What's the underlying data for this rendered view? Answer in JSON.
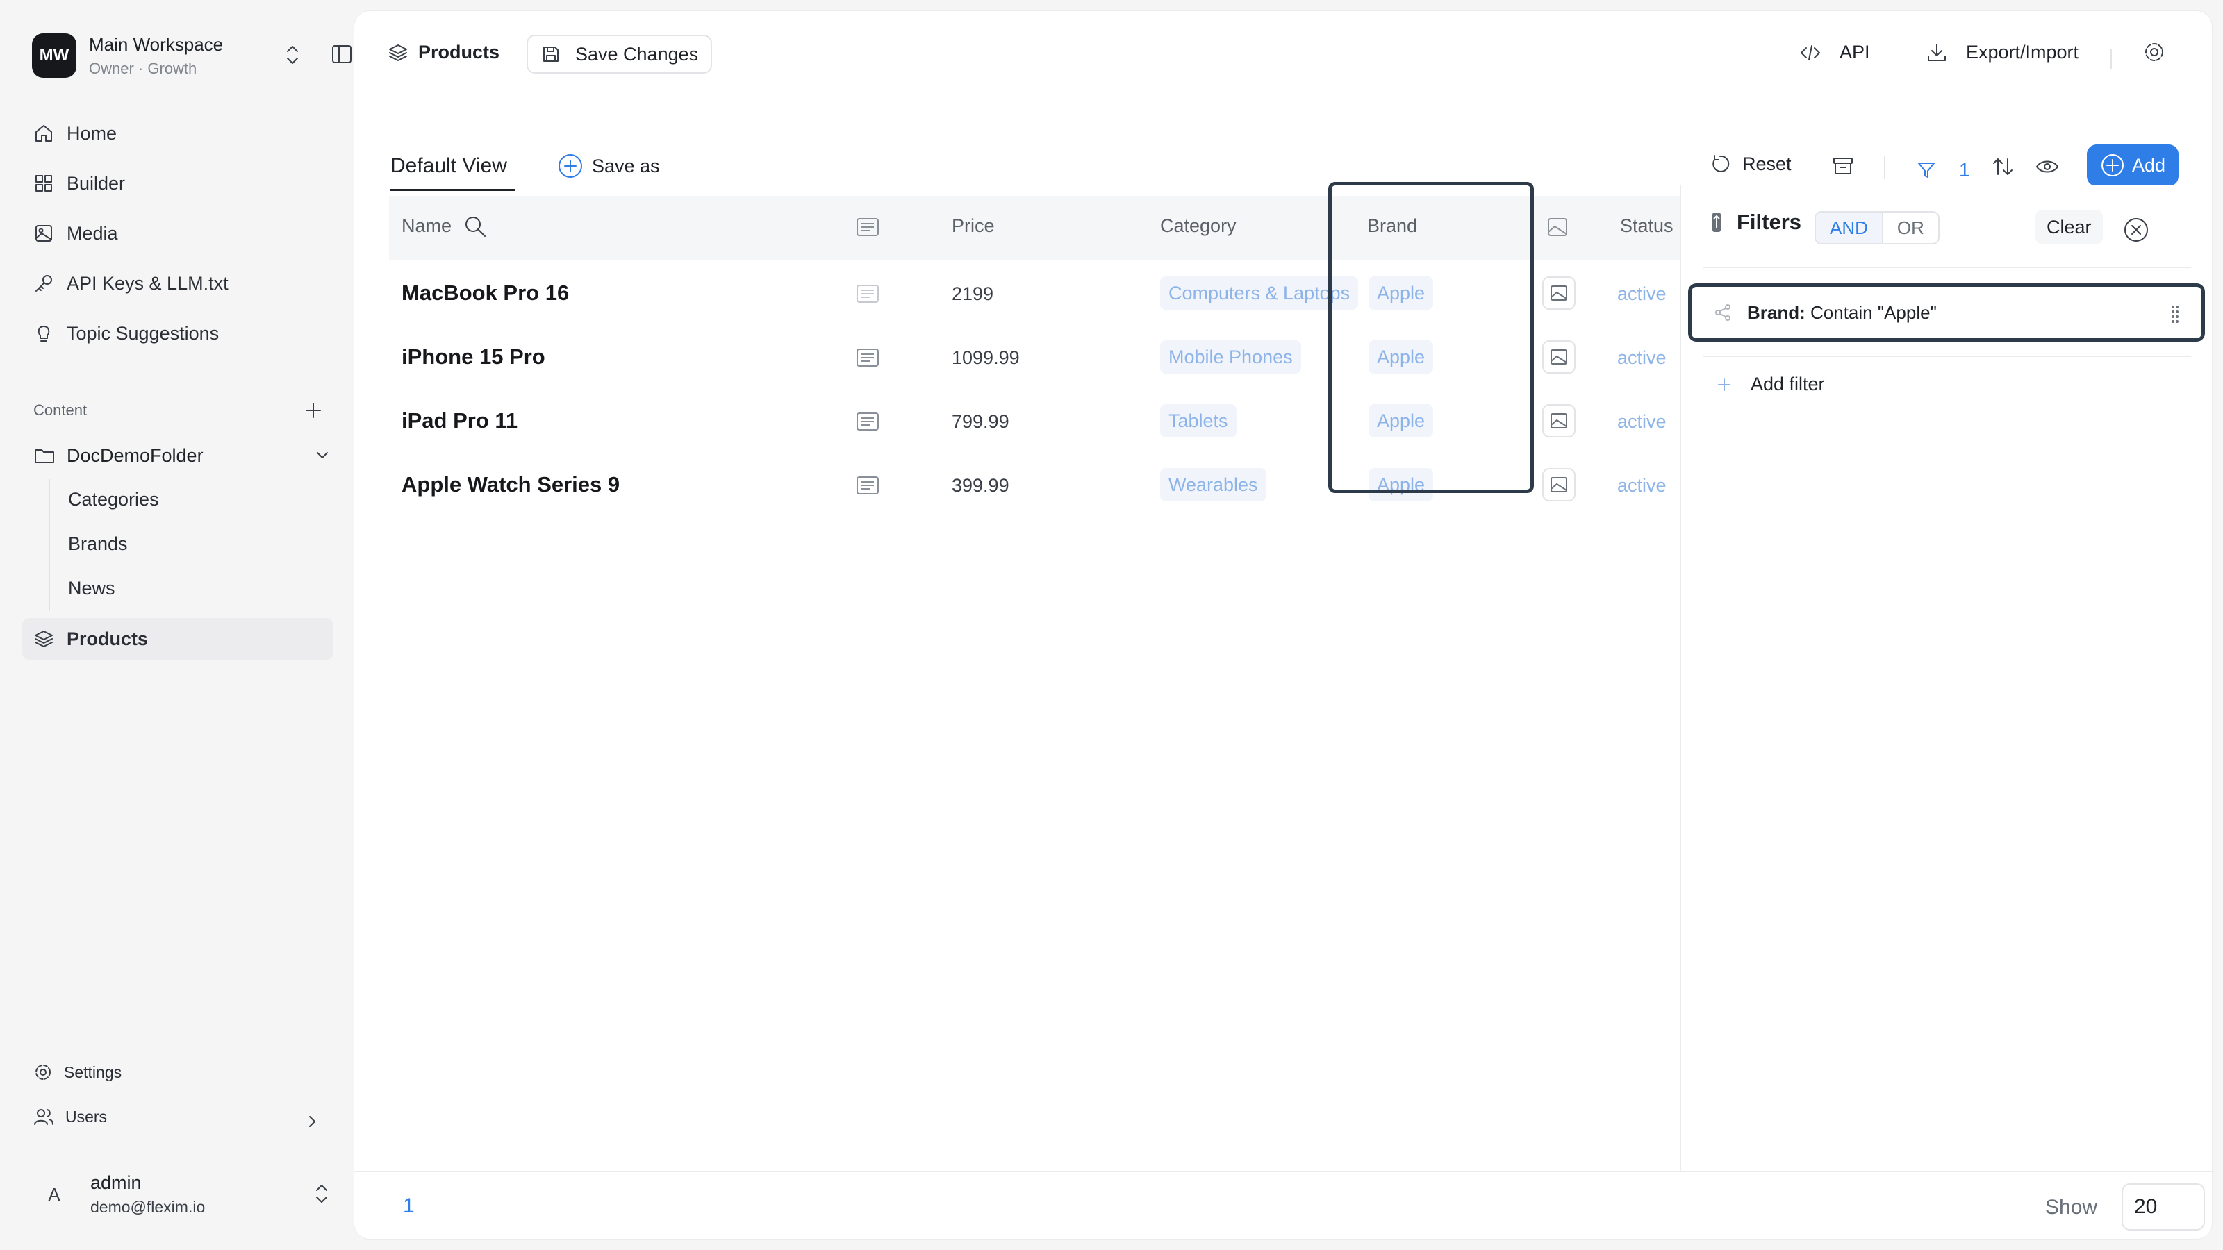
{
  "workspace": {
    "initials": "MW",
    "name": "Main Workspace",
    "subtitle": "Owner · Growth"
  },
  "nav": [
    {
      "label": "Home",
      "icon": "home-icon"
    },
    {
      "label": "Builder",
      "icon": "grid-icon"
    },
    {
      "label": "Media",
      "icon": "image-icon"
    },
    {
      "label": "API Keys & LLM.txt",
      "icon": "key-icon"
    },
    {
      "label": "Topic Suggestions",
      "icon": "lightbulb-icon"
    }
  ],
  "content": {
    "section_label": "Content",
    "folder": "DocDemoFolder",
    "subitems": [
      "Categories",
      "Brands",
      "News"
    ],
    "active_item": "Products"
  },
  "bottom": {
    "settings": "Settings",
    "users": "Users"
  },
  "user": {
    "avatar": "A",
    "name": "admin",
    "email": "demo@flexim.io"
  },
  "topbar": {
    "breadcrumb": "Products",
    "save": "Save Changes",
    "api": "API",
    "export": "Export/Import"
  },
  "view": {
    "tab": "Default View",
    "save_as": "Save as",
    "reset": "Reset",
    "filter_count": "1",
    "add": "Add"
  },
  "table": {
    "columns": {
      "name": "Name",
      "price": "Price",
      "category": "Category",
      "brand": "Brand",
      "status": "Status"
    },
    "rows": [
      {
        "name": "MacBook Pro 16",
        "price": "2199",
        "category": "Computers & Laptops",
        "brand": "Apple",
        "status": "active"
      },
      {
        "name": "iPhone 15 Pro",
        "price": "1099.99",
        "category": "Mobile Phones",
        "brand": "Apple",
        "status": "active"
      },
      {
        "name": "iPad Pro 11",
        "price": "799.99",
        "category": "Tablets",
        "brand": "Apple",
        "status": "active"
      },
      {
        "name": "Apple Watch Series 9",
        "price": "399.99",
        "category": "Wearables",
        "brand": "Apple",
        "status": "active"
      }
    ]
  },
  "filters": {
    "title": "Filters",
    "and": "AND",
    "or": "OR",
    "clear": "Clear",
    "rule_field": "Brand:",
    "rule_text": "Contain \"Apple\"",
    "add_filter": "Add filter"
  },
  "footer": {
    "page": "1",
    "show_label": "Show",
    "page_size": "20"
  },
  "colors": {
    "accent": "#2f7de6",
    "tag_text": "#8db4e8",
    "highlight": "#2d3a4a"
  }
}
